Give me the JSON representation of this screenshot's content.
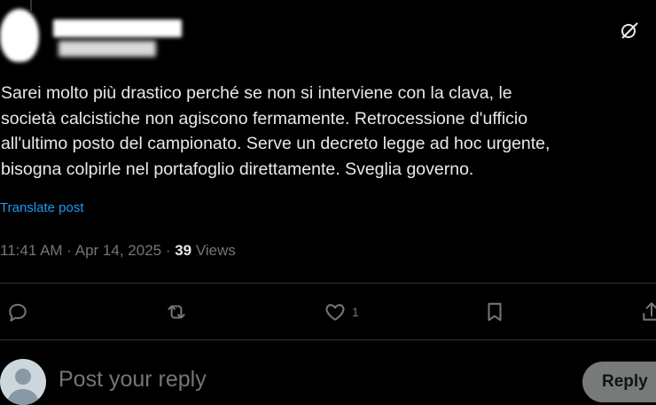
{
  "post": {
    "text": "Sarei molto più drastico perché se non si interviene con la clava, le\nsocietà calcistiche non agiscono fermamente. Retrocessione d'ufficio\nall'ultimo posto del campionato. Serve un decreto legge ad hoc urgente,\nbisogna colpirle nel portafoglio direttamente. Sveglia governo.",
    "translate_label": "Translate post",
    "time": "11:41 AM",
    "separator": " · ",
    "date": "Apr 14, 2025",
    "views_count": "39",
    "views_label": " Views"
  },
  "actions": {
    "reply_icon": "reply-icon",
    "repost_icon": "repost-icon",
    "like_icon": "heart-icon",
    "like_count": "1",
    "bookmark_icon": "bookmark-icon",
    "share_icon": "share-icon"
  },
  "composer": {
    "placeholder": "Post your reply",
    "reply_button": "Reply"
  },
  "colors": {
    "background": "#000000",
    "text": "#e7e9ea",
    "muted": "#71767b",
    "link": "#1d9bf0"
  }
}
